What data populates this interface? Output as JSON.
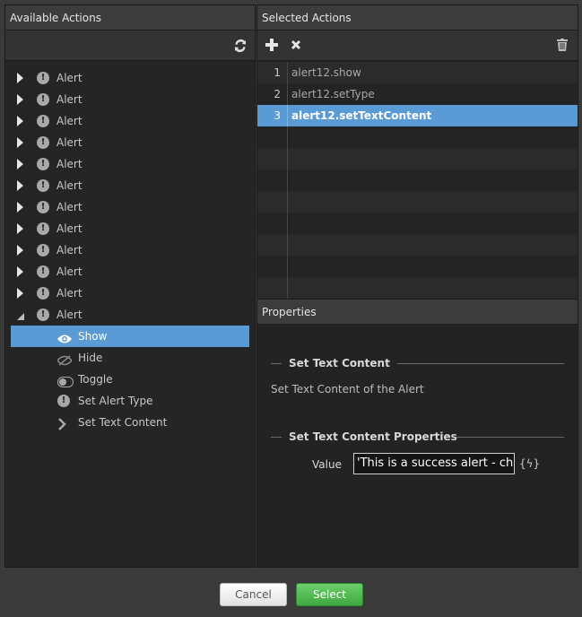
{
  "left_panel": {
    "title": "Available Actions",
    "refresh_icon": "refresh-icon",
    "tree": [
      {
        "label": "Alert",
        "expanded": false
      },
      {
        "label": "Alert",
        "expanded": false
      },
      {
        "label": "Alert",
        "expanded": false
      },
      {
        "label": "Alert",
        "expanded": false
      },
      {
        "label": "Alert",
        "expanded": false
      },
      {
        "label": "Alert",
        "expanded": false
      },
      {
        "label": "Alert",
        "expanded": false
      },
      {
        "label": "Alert",
        "expanded": false
      },
      {
        "label": "Alert",
        "expanded": false
      },
      {
        "label": "Alert",
        "expanded": false
      },
      {
        "label": "Alert",
        "expanded": false
      },
      {
        "label": "Alert",
        "expanded": true
      }
    ],
    "children": [
      {
        "label": "Show",
        "icon": "eye-icon",
        "selected": true
      },
      {
        "label": "Hide",
        "icon": "eye-slash-icon",
        "selected": false
      },
      {
        "label": "Toggle",
        "icon": "toggle-icon",
        "selected": false
      },
      {
        "label": "Set Alert Type",
        "icon": "alert-icon",
        "selected": false
      },
      {
        "label": "Set Text Content",
        "icon": "chevron-right-icon",
        "selected": false
      }
    ]
  },
  "selected_panel": {
    "title": "Selected Actions",
    "add_icon": "plus-icon",
    "remove_icon": "close-icon",
    "trash_icon": "trash-icon",
    "items": [
      {
        "num": "1",
        "text": "alert12.show"
      },
      {
        "num": "2",
        "text": "alert12.setType"
      },
      {
        "num": "3",
        "text": "alert12.setTextContent"
      }
    ]
  },
  "properties": {
    "title": "Properties",
    "section1_title": "Set Text Content",
    "section1_desc": "Set Text Content of the Alert",
    "section2_title": "Set Text Content Properties",
    "value_label": "Value",
    "value": "'This is a success alert - check it out!'",
    "fx_label": "{ϟ}"
  },
  "footer": {
    "cancel_label": "Cancel",
    "select_label": "Select"
  },
  "colors": {
    "selection": "#5b9bd5",
    "select_button": "#4cb84c"
  }
}
